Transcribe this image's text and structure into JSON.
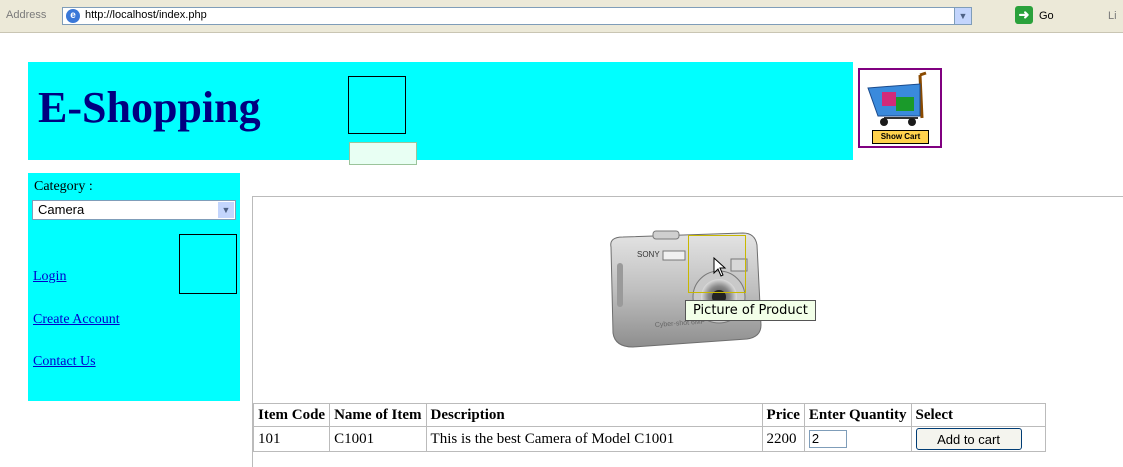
{
  "browser": {
    "address_label": "Address",
    "url": "http://localhost/index.php",
    "go_label": "Go",
    "links_label": "Li"
  },
  "header": {
    "title": "E-Shopping",
    "cart_label": "Show Cart"
  },
  "sidebar": {
    "category_label": "Category :",
    "category_value": "Camera",
    "links": [
      "Login",
      "Create Account",
      "Contact Us"
    ]
  },
  "product": {
    "tooltip": "Picture of Product"
  },
  "table": {
    "headers": [
      "Item Code",
      "Name of Item",
      "Description",
      "Price",
      "Enter Quantity",
      "Select"
    ],
    "rows": [
      {
        "item_code": "101",
        "name": "C1001",
        "description": "This is the best Camera of Model C1001",
        "price": "2200",
        "quantity": "2",
        "select_label": "Add to cart"
      }
    ]
  },
  "colors": {
    "panel": "#00ffff",
    "title": "#000080",
    "link": "#0000cc",
    "cart_border": "#800080"
  }
}
